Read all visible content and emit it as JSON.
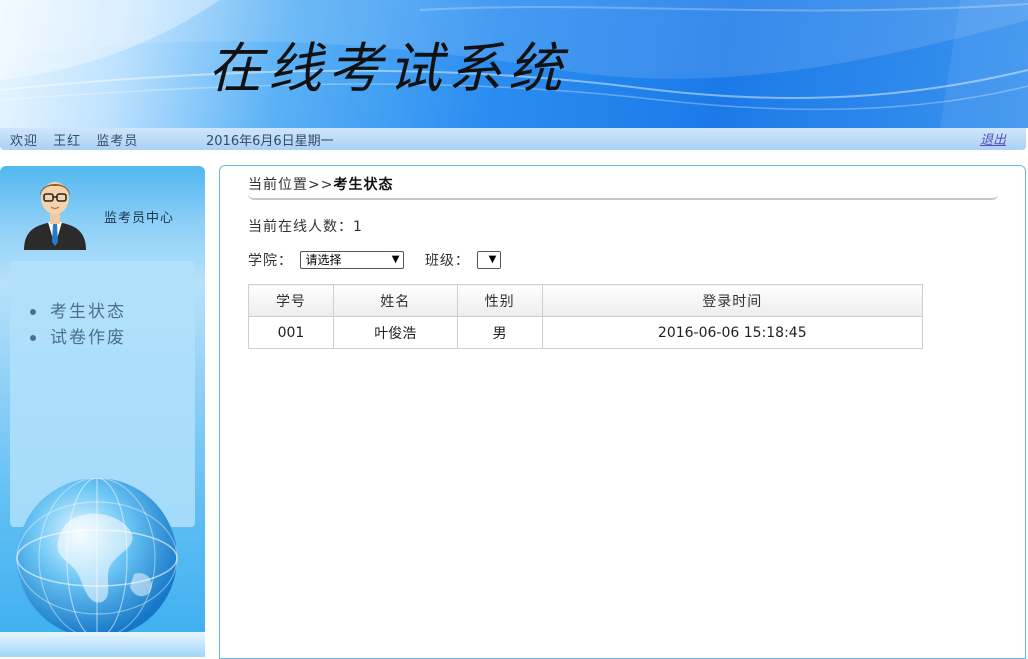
{
  "banner": {
    "title": "在线考试系统"
  },
  "infobar": {
    "welcome": "欢迎",
    "user_name": "王红",
    "role": "监考员",
    "date": "2016年6月6日星期一",
    "logout_label": "退出"
  },
  "sidebar": {
    "center_label": "监考员中心",
    "menu": [
      {
        "label": "考生状态"
      },
      {
        "label": "试卷作废"
      }
    ]
  },
  "main": {
    "breadcrumb_prefix": "当前位置>>",
    "breadcrumb_current": "考生状态",
    "online_count_label": "当前在线人数：1",
    "college_label": "学院：",
    "college_selected": "请选择",
    "class_label": "班级：",
    "class_selected": "",
    "table": {
      "headers": [
        "学号",
        "姓名",
        "性别",
        "登录时间"
      ],
      "rows": [
        [
          "001",
          "叶俊浩",
          "男",
          "2016-06-06 15:18:45"
        ]
      ]
    }
  },
  "colors": {
    "banner_blue": "#1b7ae8",
    "sidebar_blue": "#52b7f1",
    "main_border": "#6ab8ea",
    "logout_link": "#5b4fb8"
  }
}
